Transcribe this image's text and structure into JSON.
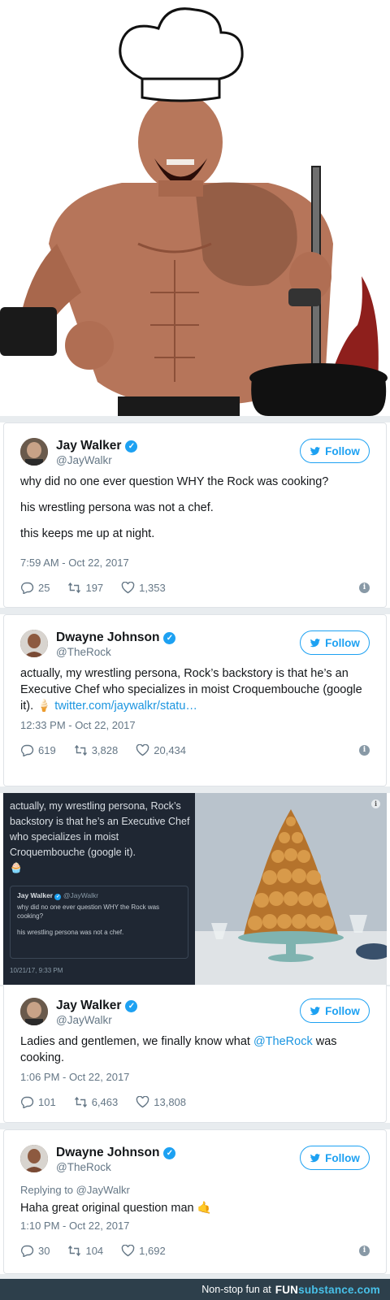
{
  "footer": {
    "tagline": "Non-stop fun at",
    "brand_main": "FUN",
    "brand_sub": "substance.com"
  },
  "follow_label": "Follow",
  "tweets": [
    {
      "name": "Jay Walker",
      "handle": "@JayWalkr",
      "lines": [
        "why did no one ever question WHY the Rock was cooking?",
        "his wrestling persona was not a chef.",
        "this keeps me up at night."
      ],
      "time": "7:59 AM - Oct 22, 2017",
      "replies": "25",
      "retweets": "197",
      "likes": "1,353"
    },
    {
      "name": "Dwayne Johnson",
      "handle": "@TheRock",
      "text": "actually, my wrestling persona, Rock’s backstory is that he’s an Executive Chef who specializes in moist Croquembouche (google it).",
      "link": "twitter.com/jaywalkr/statu…",
      "time": "12:33 PM - Oct 22, 2017",
      "replies": "619",
      "retweets": "3,828",
      "likes": "20,434"
    },
    {
      "name": "Jay Walker",
      "handle": "@JayWalkr",
      "text_before": "Ladies and gentlemen, we finally know what",
      "mention": "@TheRock",
      "text_after": "was cooking.",
      "time": "1:06 PM - Oct 22, 2017",
      "replies": "101",
      "retweets": "6,463",
      "likes": "13,808"
    },
    {
      "name": "Dwayne Johnson",
      "handle": "@TheRock",
      "reply_prefix": "Replying to",
      "reply_to": "@JayWalkr",
      "text": "Haha great original question man",
      "time": "1:10 PM - Oct 22, 2017",
      "replies": "30",
      "retweets": "104",
      "likes": "1,692"
    }
  ],
  "embed": {
    "text": "actually, my wrestling persona, Rock’s backstory is that he’s an Executive Chef who specializes in moist Croquembouche (google it).",
    "quote_name": "Jay Walker",
    "quote_handle": "@JayWalkr",
    "quote_text": "why did no one ever question WHY the Rock was cooking?",
    "quote_text2": "his wrestling persona was not a chef.",
    "date": "10/21/17, 9:33 PM"
  },
  "colors": {
    "twitter_blue": "#1da1f2",
    "footer_bg": "#2d3f4b",
    "brand_accent": "#48c0e8",
    "embed_dark": "#1f2733"
  },
  "icons": [
    "chef-hat-icon",
    "verified-icon",
    "bird-icon",
    "reply-icon",
    "retweet-icon",
    "like-icon",
    "info-icon"
  ]
}
